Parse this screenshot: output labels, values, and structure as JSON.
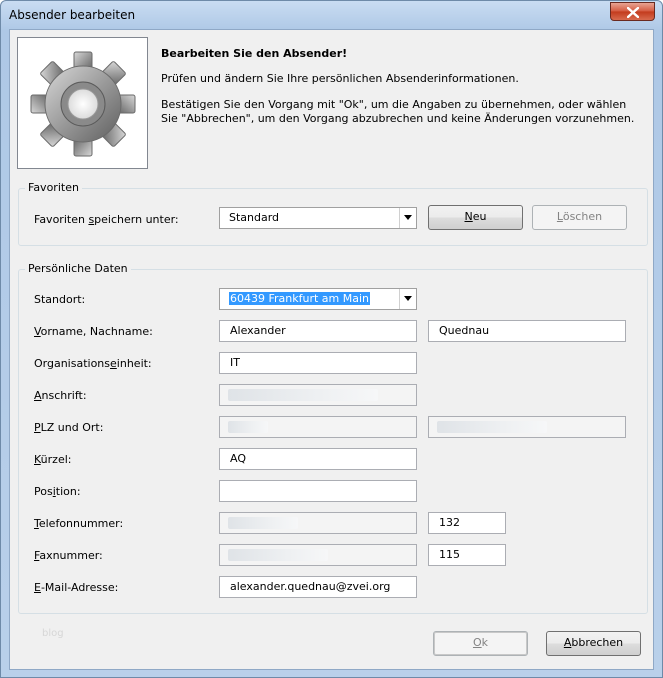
{
  "window": {
    "title": "Absender bearbeiten"
  },
  "header": {
    "title": "Bearbeiten Sie den Absender!",
    "line1": "Prüfen und ändern Sie Ihre persönlichen Absenderinformationen.",
    "line2": "Bestätigen Sie den Vorgang mit \"Ok\", um die Angaben zu übernehmen, oder wählen Sie \"Abbrechen\", um den Vorgang abzubrechen und keine Änderungen vorzunehmen."
  },
  "favorites": {
    "legend": "Favoriten",
    "label_pre": "Favoriten ",
    "label_u": "s",
    "label_post": "peichern unter:",
    "selected": "Standard",
    "new_u": "N",
    "new_rest": "eu",
    "delete_u": "L",
    "delete_rest": "öschen"
  },
  "personal": {
    "legend": "Persönliche Daten",
    "location_label": "Standort:",
    "location_value": "60439 Frankfurt am Main",
    "name_label_u": "V",
    "name_label_rest": "orname, Nachname:",
    "first_name": "Alexander",
    "last_name": "Quednau",
    "org_label_pre": "Organisations",
    "org_label_u": "e",
    "org_label_post": "inheit:",
    "org_value": "IT",
    "address_label_u": "A",
    "address_label_rest": "nschrift:",
    "zip_label_u": "P",
    "zip_label_rest": "LZ und Ort:",
    "short_label_u": "K",
    "short_label_rest": "ürzel:",
    "short_value": "AQ",
    "position_label_pre": "Pos",
    "position_label_u": "i",
    "position_label_post": "tion:",
    "phone_label_u": "T",
    "phone_label_rest": "elefonnummer:",
    "phone_ext": "132",
    "fax_label_u": "F",
    "fax_label_rest": "axnummer:",
    "fax_ext": "115",
    "email_label_u": "E",
    "email_label_rest": "-Mail-Adresse:",
    "email_value": "alexander.quednau@zvei.org"
  },
  "footer": {
    "watermark": "blog",
    "ok_u": "O",
    "ok_rest": "k",
    "cancel_u": "A",
    "cancel_rest": "bbrechen"
  },
  "icons": {
    "header": "gear-icon",
    "close": "close-icon",
    "combo": "chevron-down-icon"
  }
}
